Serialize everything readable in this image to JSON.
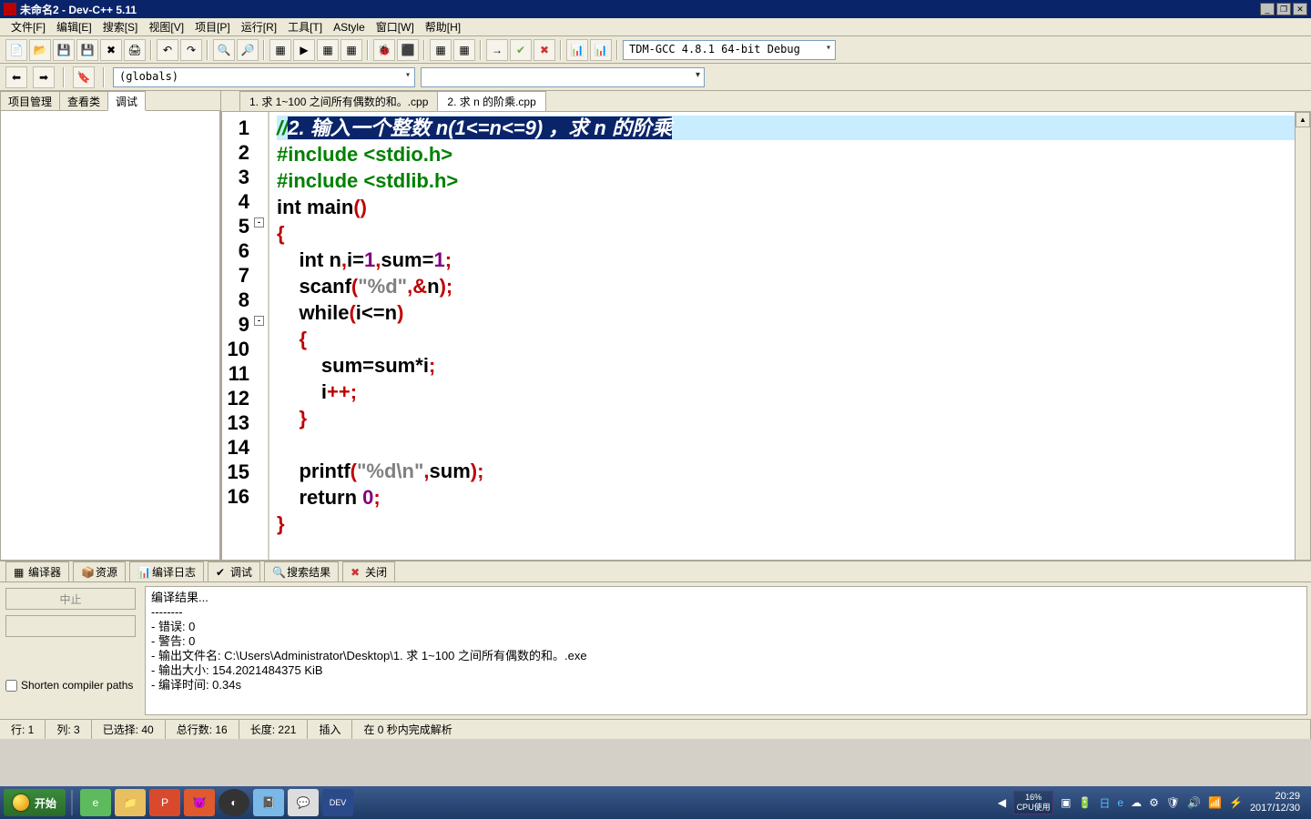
{
  "title": "未命名2 - Dev-C++ 5.11",
  "menus": [
    "文件[F]",
    "编辑[E]",
    "搜索[S]",
    "视图[V]",
    "项目[P]",
    "运行[R]",
    "工具[T]",
    "AStyle",
    "窗口[W]",
    "帮助[H]"
  ],
  "compiler_combo": "TDM-GCC 4.8.1 64-bit Debug",
  "globals_combo": "(globals)",
  "side_tabs": [
    "项目管理",
    "查看类",
    "调试"
  ],
  "side_active": 2,
  "file_tabs": [
    "1. 求 1~100 之间所有偶数的和。.cpp",
    "2. 求 n 的阶乘.cpp"
  ],
  "file_active": 1,
  "line_numbers": [
    "1",
    "2",
    "3",
    "4",
    "5",
    "6",
    "7",
    "8",
    "9",
    "10",
    "11",
    "12",
    "13",
    "14",
    "15",
    "16"
  ],
  "code": {
    "l1_comment_prefix": "//",
    "l1_comment_sel": "2. 输入一个整数 n(1<=n<=9) ，求 n 的阶乘",
    "l2": "#include <stdio.h>",
    "l3": "#include <stdlib.h>",
    "l4_int": "int",
    "l4_main": " main",
    "l4_par": "()",
    "l5": "{",
    "l6_int": "    int",
    "l6_rest": " n",
    "l6_c1": ",",
    "l6_i": "i",
    "l6_eq1": "=",
    "l6_1": "1",
    "l6_c2": ",",
    "l6_sum": "sum",
    "l6_eq2": "=",
    "l6_1b": "1",
    "l6_sc": ";",
    "l7_a": "    scanf",
    "l7_p1": "(",
    "l7_s": "\"%d\"",
    "l7_c": ",",
    "l7_amp": "&",
    "l7_n": "n",
    "l7_p2": ")",
    "l7_sc": ";",
    "l8_a": "    while",
    "l8_p1": "(",
    "l8_i": "i",
    "l8_op": "<=",
    "l8_n": "n",
    "l8_p2": ")",
    "l9": "    {",
    "l10_a": "        sum",
    "l10_eq": "=",
    "l10_b": "sum",
    "l10_op": "*",
    "l10_i": "i",
    "l10_sc": ";",
    "l11_a": "        i",
    "l11_op": "++;",
    "l12": "    }",
    "l13": "",
    "l14_a": "    printf",
    "l14_p1": "(",
    "l14_s": "\"%d\\n\"",
    "l14_c": ",",
    "l14_sum": "sum",
    "l14_p2": ")",
    "l14_sc": ";",
    "l15_a": "    return",
    "l15_sp": " ",
    "l15_0": "0",
    "l15_sc": ";",
    "l16": "}"
  },
  "bottom_tabs": [
    "编译器",
    "资源",
    "编译日志",
    "调试",
    "搜索结果",
    "关闭"
  ],
  "log_left": {
    "abort": "中止",
    "shorten": "Shorten compiler paths"
  },
  "log_lines": [
    "编译结果...",
    "--------",
    "- 错误: 0",
    "- 警告: 0",
    "- 输出文件名: C:\\Users\\Administrator\\Desktop\\1. 求 1~100 之间所有偶数的和。.exe",
    "- 输出大小: 154.2021484375 KiB",
    "- 编译时间: 0.34s"
  ],
  "status": {
    "row": "行:  1",
    "col": "列:  3",
    "sel": "已选择:  40",
    "total": "总行数:  16",
    "len": "长度:  221",
    "ins": "插入",
    "msg": "在 0 秒内完成解析"
  },
  "taskbar": {
    "start": "开始",
    "clock1": "20:29",
    "clock2": "2017/12/30",
    "cpu1": "16%",
    "cpu2": "CPU使用"
  }
}
